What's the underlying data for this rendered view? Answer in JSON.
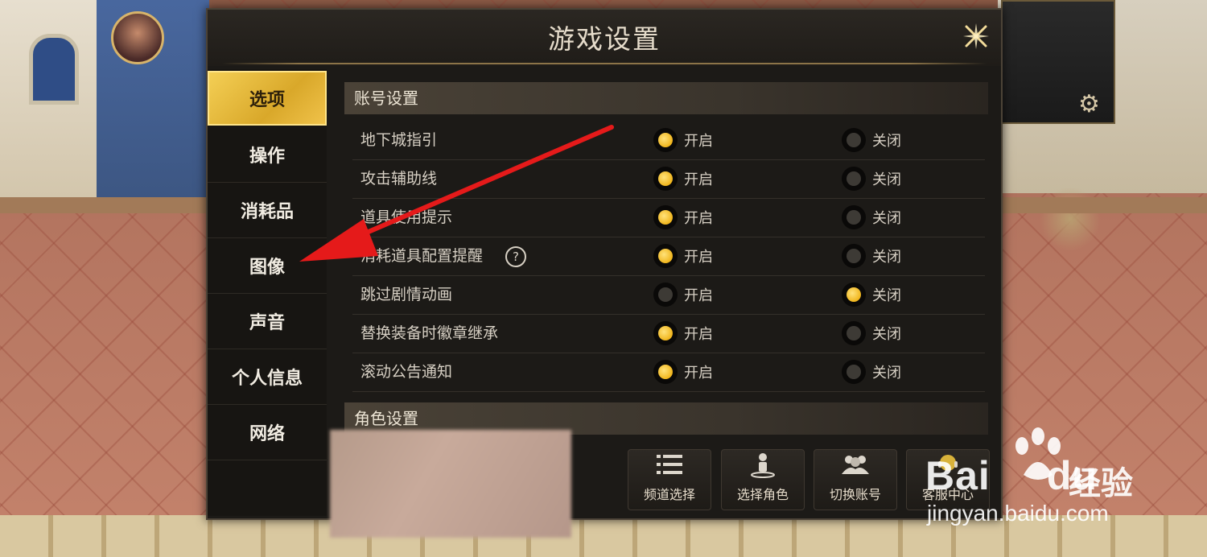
{
  "dialog": {
    "title": "游戏设置"
  },
  "sidebar": {
    "items": [
      {
        "label": "选项",
        "active": true
      },
      {
        "label": "操作",
        "active": false
      },
      {
        "label": "消耗品",
        "active": false
      },
      {
        "label": "图像",
        "active": false
      },
      {
        "label": "声音",
        "active": false
      },
      {
        "label": "个人信息",
        "active": false
      },
      {
        "label": "网络",
        "active": false
      }
    ]
  },
  "account_section": {
    "title": "账号设置",
    "on_label": "开启",
    "off_label": "关闭",
    "rows": [
      {
        "label": "地下城指引",
        "selected": "on",
        "has_help": false
      },
      {
        "label": "攻击辅助线",
        "selected": "on",
        "has_help": false
      },
      {
        "label": "道具使用提示",
        "selected": "on",
        "has_help": false
      },
      {
        "label": "消耗道具配置提醒",
        "selected": "on",
        "has_help": true
      },
      {
        "label": "跳过剧情动画",
        "selected": "off",
        "has_help": false
      },
      {
        "label": "替换装备时徽章继承",
        "selected": "on",
        "has_help": false
      },
      {
        "label": "滚动公告通知",
        "selected": "on",
        "has_help": false
      }
    ]
  },
  "character_section": {
    "title": "角色设置"
  },
  "bottom_buttons": [
    {
      "label": "频道选择",
      "icon": "list-icon"
    },
    {
      "label": "选择角色",
      "icon": "character-select-icon"
    },
    {
      "label": "切换账号",
      "icon": "switch-account-icon"
    },
    {
      "label": "客服中心",
      "icon": "customer-service-icon"
    }
  ],
  "help_glyph": "?",
  "watermark": {
    "logo": "Bai",
    "logo_tail": "du",
    "cn": "经验",
    "url": "jingyan.baidu.com"
  },
  "colors": {
    "accent_gold": "#f0b51c",
    "arrow_red": "#e51a1a"
  }
}
